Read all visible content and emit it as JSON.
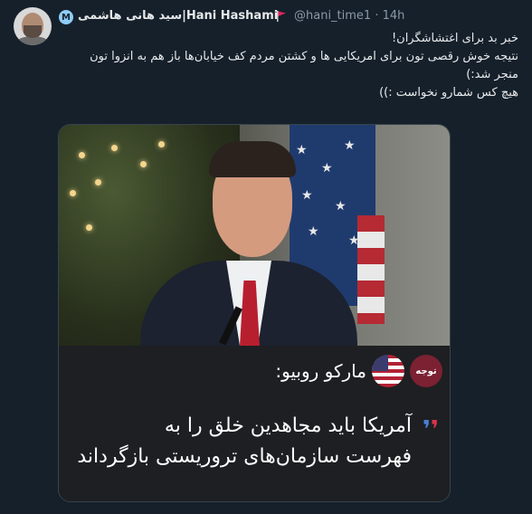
{
  "tweet": {
    "display_name_rtl": "سید هانی هاشمی",
    "display_name_latin": "|Hani Hashami",
    "badge_letter": "M",
    "handle": "@hani_time1",
    "time": "· 14h",
    "lines": [
      "خبر بد برای اغتشاشگران!",
      "نتیجه خوش رقصی تون برای امریکایی ها و کشتن مردم کف خیابان‌ها باز هم به انزوا تون",
      "منجر شد:)",
      "هیچ کس شمارو نخواست :))"
    ]
  },
  "card": {
    "logo_text": "توجه",
    "title": "مارکو روبیو:",
    "quote_lines": [
      "آمریکا باید مجاهدین خلق را به",
      "فهرست سازمان‌های تروریستی بازگرداند"
    ]
  },
  "icons": {
    "avatar": "avatar-photo",
    "flag": "red-flag-icon",
    "verified": "m-badge-icon",
    "country": "us-flag-icon"
  },
  "colors": {
    "background": "#15202b",
    "text": "#e7e9ea",
    "muted": "#8b98a5",
    "accent_logo": "#7b2132"
  }
}
